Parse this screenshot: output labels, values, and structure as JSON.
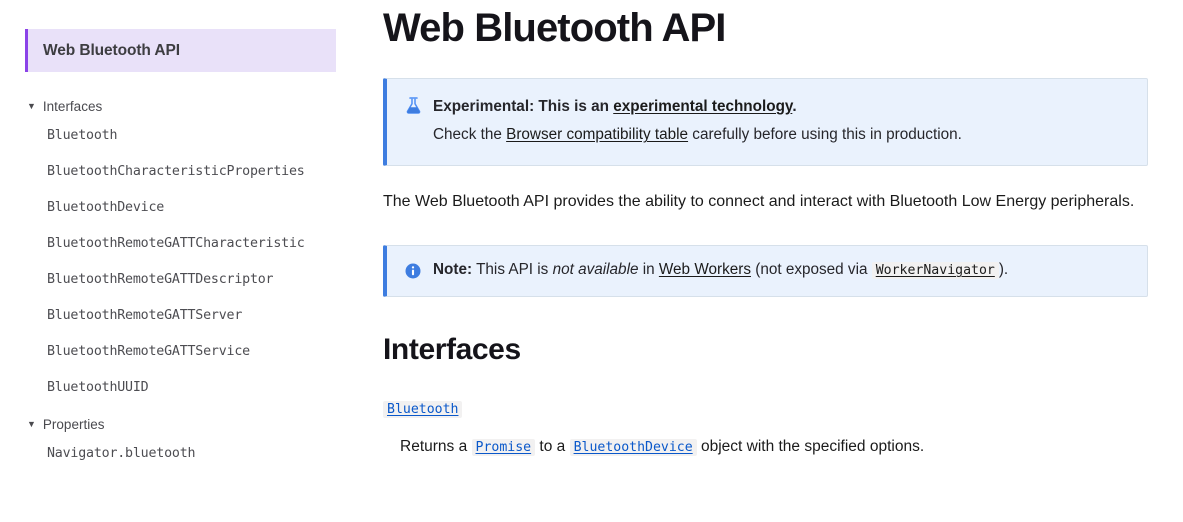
{
  "sidebar": {
    "current": {
      "label": "Web Bluetooth API"
    },
    "groups": [
      {
        "label": "Interfaces",
        "toggle_icon": "▼",
        "items": [
          {
            "label": "Bluetooth"
          },
          {
            "label": "BluetoothCharacteristicProperties"
          },
          {
            "label": "BluetoothDevice"
          },
          {
            "label": "BluetoothRemoteGATTCharacteristic"
          },
          {
            "label": "BluetoothRemoteGATTDescriptor"
          },
          {
            "label": "BluetoothRemoteGATTServer"
          },
          {
            "label": "BluetoothRemoteGATTService"
          },
          {
            "label": "BluetoothUUID"
          }
        ]
      },
      {
        "label": "Properties",
        "toggle_icon": "▼",
        "items": [
          {
            "label": "Navigator.bluetooth"
          }
        ]
      }
    ]
  },
  "main": {
    "title": "Web Bluetooth API",
    "experimental": {
      "icon": "flask-icon",
      "line1_prefix": "Experimental:",
      "line1_text": " This is an ",
      "line1_link": "experimental technology",
      "line1_suffix": ".",
      "line2_prefix": "Check the ",
      "line2_link": "Browser compatibility table",
      "line2_suffix": " carefully before using this in production."
    },
    "intro": "The Web Bluetooth API provides the ability to connect and interact with Bluetooth Low Energy peripherals.",
    "note": {
      "icon": "info-icon",
      "label": "Note:",
      "text_a": " This API is ",
      "emphasis": "not available",
      "text_b": " in ",
      "link": "Web Workers",
      "text_c": " (not exposed via ",
      "code": "WorkerNavigator",
      "text_d": ")."
    },
    "section_interfaces": "Interfaces",
    "interfaces": [
      {
        "name": "Bluetooth",
        "desc_a": "Returns a ",
        "desc_code1": "Promise",
        "desc_b": " to a ",
        "desc_code2": "BluetoothDevice",
        "desc_c": " object with the specified options."
      }
    ]
  },
  "colors": {
    "sidebar_highlight_bg": "#e9e1f9",
    "sidebar_highlight_border": "#8b43e8",
    "callout_bg": "#eaf2fd",
    "callout_border": "#3e7de0",
    "code_link": "#0a58ca",
    "code_chip_bg": "#f2f1f1"
  }
}
